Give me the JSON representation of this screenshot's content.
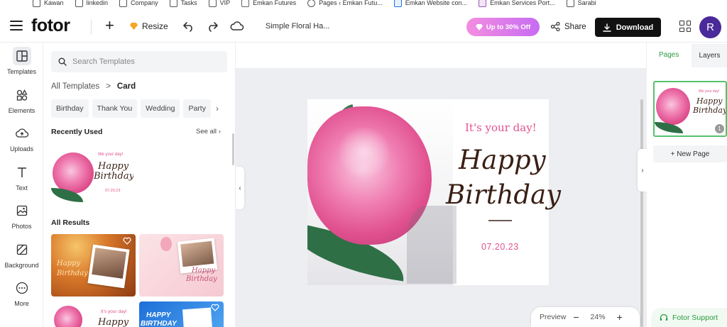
{
  "bookmarks": [
    "Kawan",
    "linkedin",
    "Company",
    "Tasks",
    "VIP",
    "Emkan Futures",
    "Pages ‹ Emkan Futu...",
    "Emkan Website con...",
    "Emkan Services Port...",
    "Sarabi"
  ],
  "toolbar": {
    "logo": "fotor",
    "plus": "+",
    "resize_label": "Resize",
    "doc_title": "Simple Floral Ha...",
    "promo_label": "Up to 30% Off",
    "share_label": "Share",
    "download_label": "Download",
    "avatar_initial": "R"
  },
  "rail": {
    "items": [
      {
        "label": "Templates",
        "icon": "templates-icon"
      },
      {
        "label": "Elements",
        "icon": "elements-icon"
      },
      {
        "label": "Uploads",
        "icon": "uploads-icon"
      },
      {
        "label": "Text",
        "icon": "text-icon"
      },
      {
        "label": "Photos",
        "icon": "photos-icon"
      },
      {
        "label": "Background",
        "icon": "background-icon"
      },
      {
        "label": "More",
        "icon": "more-icon"
      }
    ]
  },
  "panel": {
    "search_placeholder": "Search Templates",
    "breadcrumb_root": "All Templates",
    "breadcrumb_sep": ">",
    "breadcrumb_current": "Card",
    "chips": [
      "Birthday",
      "Thank You",
      "Wedding",
      "Party"
    ],
    "chip_more": "›",
    "recently_used": "Recently Used",
    "see_all": "See all",
    "all_results": "All Results",
    "thumb_texts": {
      "we_your_day": "We your day!",
      "happy": "Happy",
      "birthday": "Birthday",
      "date": "07.20.23",
      "happy_blue": "HAPPY",
      "birthday_blue": "BIRTHDAY",
      "its_your_day": "It's your day!"
    }
  },
  "canvas": {
    "subtitle": "It's your day!",
    "line1": "Happy",
    "line2": "Birthday",
    "date": "07.20.23"
  },
  "zoom": {
    "preview_label": "Preview",
    "minus": "−",
    "value": "24%",
    "plus": "+"
  },
  "right_panel": {
    "tab_pages": "Pages",
    "tab_layers": "Layers",
    "page_number": "1",
    "new_page_label": "+ New Page",
    "support_label": "Fotor Support"
  },
  "colors": {
    "accent_green": "#2b9a3e",
    "promo_start": "#f48de0",
    "promo_end": "#c66cf3",
    "card_pink": "#e0538e",
    "card_brown": "#3a1f14"
  }
}
